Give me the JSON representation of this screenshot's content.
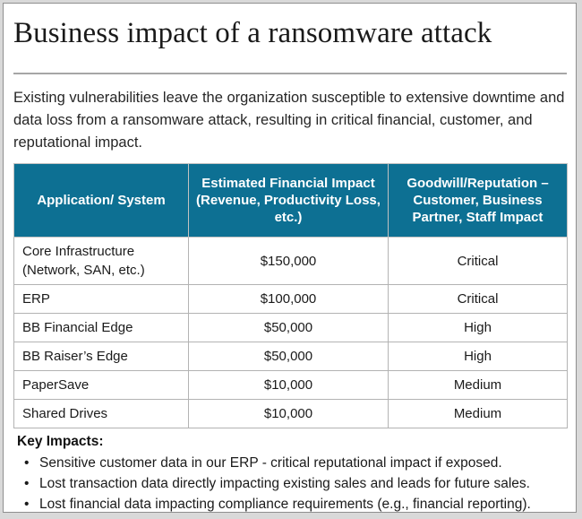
{
  "slide": {
    "title": "Business impact of a ransomware attack",
    "intro": "Existing vulnerabilities leave the organization susceptible to extensive downtime and data loss from a ransomware attack, resulting in critical financial, customer, and reputational impact.",
    "accent_color": "#0D7093",
    "border_color": "#8F8F8F"
  },
  "table": {
    "headers": [
      "Application/ System",
      "Estimated Financial Impact (Revenue, Productivity Loss, etc.)",
      "Goodwill/Reputation – Customer, Business Partner, Staff Impact"
    ],
    "rows": [
      {
        "application": "Core Infrastructure (Network, SAN, etc.)",
        "financial_impact": "$150,000",
        "goodwill_impact": "Critical"
      },
      {
        "application": "ERP",
        "financial_impact": "$100,000",
        "goodwill_impact": "Critical"
      },
      {
        "application": "BB Financial Edge",
        "financial_impact": "$50,000",
        "goodwill_impact": "High"
      },
      {
        "application": "BB Raiser’s Edge",
        "financial_impact": "$50,000",
        "goodwill_impact": "High"
      },
      {
        "application": "PaperSave",
        "financial_impact": "$10,000",
        "goodwill_impact": "Medium"
      },
      {
        "application": "Shared Drives",
        "financial_impact": "$10,000",
        "goodwill_impact": "Medium"
      }
    ]
  },
  "key_impacts": {
    "heading": "Key Impacts:",
    "bullet_glyph": "•",
    "items": [
      "Sensitive customer data in our ERP - critical reputational impact if exposed.",
      "Lost transaction data directly impacting existing sales and leads for future sales.",
      "Lost financial data impacting compliance requirements (e.g., financial reporting)."
    ]
  }
}
